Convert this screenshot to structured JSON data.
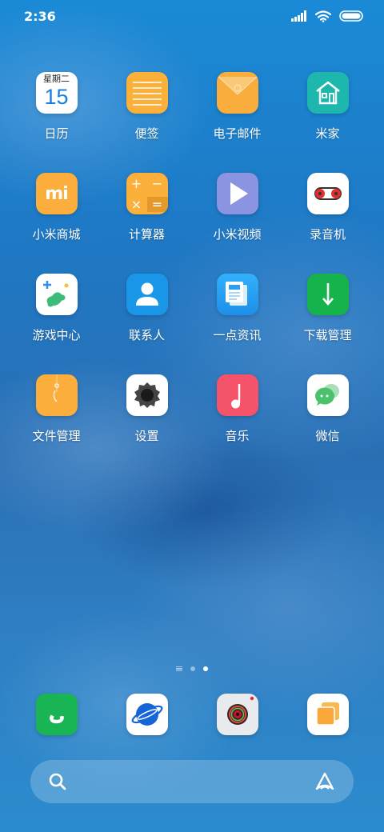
{
  "status_bar": {
    "time": "2:36"
  },
  "calendar": {
    "weekday": "星期二",
    "day": "15"
  },
  "apps": [
    {
      "label": "日历"
    },
    {
      "label": "便签"
    },
    {
      "label": "电子邮件"
    },
    {
      "label": "米家"
    },
    {
      "label": "小米商城"
    },
    {
      "label": "计算器"
    },
    {
      "label": "小米视频"
    },
    {
      "label": "录音机"
    },
    {
      "label": "游戏中心"
    },
    {
      "label": "联系人"
    },
    {
      "label": "一点资讯"
    },
    {
      "label": "下载管理"
    },
    {
      "label": "文件管理"
    },
    {
      "label": "设置"
    },
    {
      "label": "音乐"
    },
    {
      "label": "微信"
    }
  ],
  "calculator_symbols": {
    "plus": "+",
    "minus": "−",
    "times": "×",
    "equals": "="
  },
  "mi_store_logo_text": "mi",
  "page_indicator": {
    "pages": 2,
    "current": 2
  },
  "dock": [
    "phone",
    "browser",
    "camera",
    "gallery"
  ],
  "colors": {
    "notes": "#fbb03b",
    "mail": "#f9ad3d",
    "mijia": "#1db7ad",
    "mistore": "#fbae3c",
    "calculator": "#fbb03b",
    "video": "#8a94e0",
    "contacts": "#1a96e8",
    "news": "#2da2f5",
    "download": "#16b24b",
    "files": "#fbae3c",
    "music": "#f4536a",
    "wechat": "#4bc16b",
    "phone": "#19b453"
  }
}
